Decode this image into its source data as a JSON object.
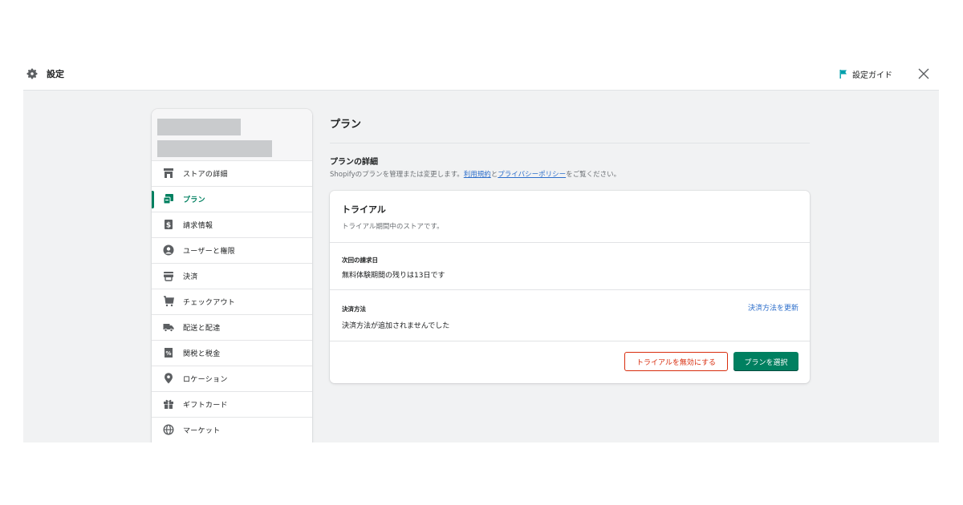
{
  "topbar": {
    "title": "設定",
    "guide_label": "設定ガイド"
  },
  "sidebar": {
    "items": [
      {
        "label": "ストアの詳細",
        "icon": "store-icon",
        "active": false
      },
      {
        "label": "プラン",
        "icon": "plan-icon",
        "active": true
      },
      {
        "label": "請求情報",
        "icon": "billing-icon",
        "active": false
      },
      {
        "label": "ユーザーと権限",
        "icon": "user-icon",
        "active": false
      },
      {
        "label": "決済",
        "icon": "payments-icon",
        "active": false
      },
      {
        "label": "チェックアウト",
        "icon": "cart-icon",
        "active": false
      },
      {
        "label": "配送と配達",
        "icon": "truck-icon",
        "active": false
      },
      {
        "label": "関税と税金",
        "icon": "tax-icon",
        "active": false
      },
      {
        "label": "ロケーション",
        "icon": "location-icon",
        "active": false
      },
      {
        "label": "ギフトカード",
        "icon": "gift-icon",
        "active": false
      },
      {
        "label": "マーケット",
        "icon": "globe-icon",
        "active": false
      }
    ]
  },
  "main": {
    "page_title": "プラン",
    "section_title": "プランの詳細",
    "section_desc_prefix": "Shopifyのプランを管理または変更します。",
    "terms_link": "利用規約",
    "and_text": "と",
    "privacy_link": "プライバシーポリシー",
    "section_desc_suffix": "をご覧ください。"
  },
  "card": {
    "title": "トライアル",
    "subtitle": "トライアル期間中のストアです。",
    "next_billing_label": "次回の請求日",
    "next_billing_value": "無料体験期間の残りは13日です",
    "payment_method_label": "決済方法",
    "payment_method_value": "決済方法が追加されませんでした",
    "update_payment_link": "決済方法を更新",
    "disable_trial_button": "トライアルを無効にする",
    "select_plan_button": "プランを選択"
  },
  "colors": {
    "accent": "#008060",
    "link": "#2c6ecb",
    "critical": "#d82c0d",
    "guide_flag": "#00a0ac"
  }
}
